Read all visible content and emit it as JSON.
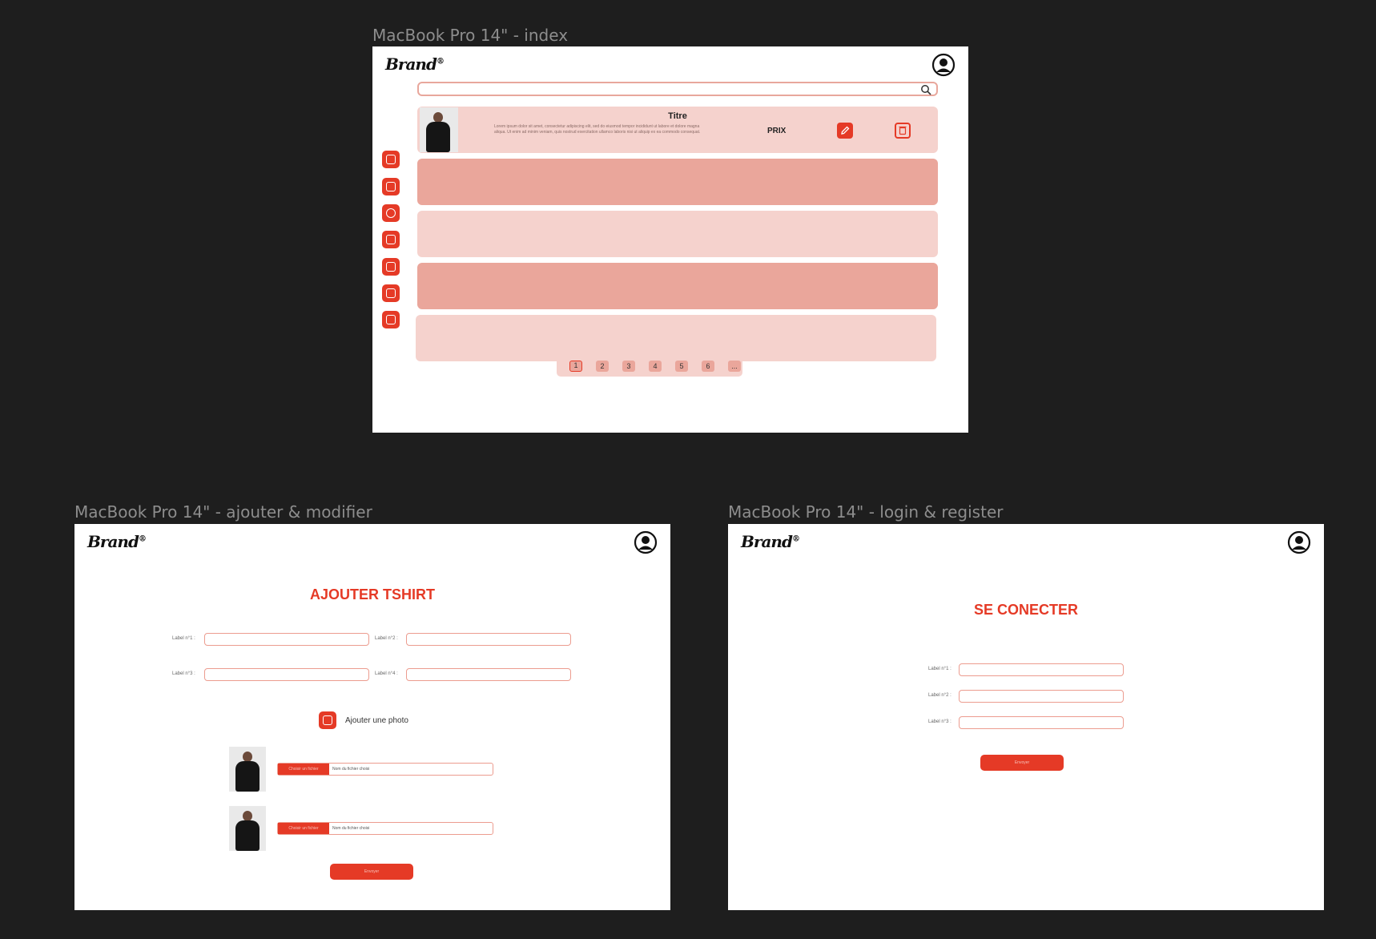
{
  "frames": {
    "index": {
      "label": "MacBook Pro 14\" - index"
    },
    "ajouter": {
      "label": "MacBook Pro 14\" - ajouter & modifier"
    },
    "login": {
      "label": "MacBook Pro 14\" - login & register"
    }
  },
  "logo": {
    "text": "Brand",
    "mark": "®"
  },
  "icons": {
    "avatar": "user-circle-icon",
    "search": "search-icon",
    "sidebar": [
      "plus-square-icon",
      "image-icon",
      "info-icon",
      "mail-icon",
      "chart-icon",
      "activity-icon",
      "calendar-icon"
    ],
    "edit": "pencil-icon",
    "delete": "trash-icon",
    "add_photo": "plus-square-icon"
  },
  "colors": {
    "accent": "#e53a26",
    "row_dark": "#eaa69b",
    "row_light": "#f5d2cd",
    "canvas": "#1e1e1e"
  },
  "index": {
    "search": {
      "placeholder": ""
    },
    "product": {
      "title": "Titre",
      "description": "Lorem ipsum dolor sit amet, consectetur adipiscing elit, sed do eiusmod tempor incididunt ut labore et dolore magna aliqua. Ut enim ad minim veniam, quis nostrud exercitation ullamco laboris nisi ut aliquip ex ea commodo consequat.",
      "price": "PRIX"
    },
    "pagination": [
      "1",
      "2",
      "3",
      "4",
      "5",
      "6",
      "..."
    ]
  },
  "ajouter": {
    "title": "AJOUTER TSHIRT",
    "labels": [
      "Label n°1 :",
      "Label n°2 :",
      "Label n°3 :",
      "Label n°4 :"
    ],
    "add_photo": "Ajouter une photo",
    "file_button": "Choisir un fichier",
    "file_name": "Nom du fichier choisi",
    "submit": "Envoyer"
  },
  "login": {
    "title": "SE CONECTER",
    "labels": [
      "Label n°1 :",
      "Label n°2 :",
      "Label n°3 :"
    ],
    "submit": "Envoyer"
  }
}
